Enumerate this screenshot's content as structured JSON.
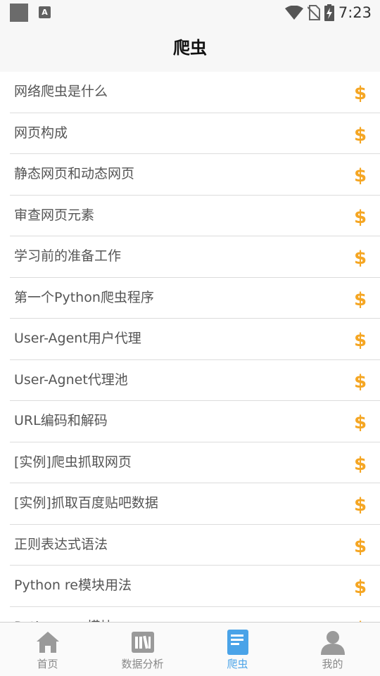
{
  "status_bar": {
    "time": "7:23",
    "icons": [
      "app-square-icon",
      "text-a-icon",
      "wifi-icon",
      "no-sim-icon",
      "battery-charging-icon"
    ]
  },
  "header": {
    "title": "爬虫"
  },
  "list": {
    "items": [
      {
        "label": "网络爬虫是什么"
      },
      {
        "label": "网页构成"
      },
      {
        "label": "静态网页和动态网页"
      },
      {
        "label": "审查网页元素"
      },
      {
        "label": "学习前的准备工作"
      },
      {
        "label": "第一个Python爬虫程序"
      },
      {
        "label": "User-Agent用户代理"
      },
      {
        "label": "User-Agnet代理池"
      },
      {
        "label": "URL编码和解码"
      },
      {
        "label": "[实例]爬虫抓取网页"
      },
      {
        "label": "[实例]抓取百度贴吧数据"
      },
      {
        "label": "正则表达式语法"
      },
      {
        "label": "Python re模块用法"
      },
      {
        "label": "Python csv模块"
      }
    ],
    "item_icon": "dollar-icon",
    "icon_color": "#f5a623"
  },
  "tabs": [
    {
      "label": "首页",
      "icon": "home-icon",
      "active": false
    },
    {
      "label": "数据分析",
      "icon": "books-icon",
      "active": false
    },
    {
      "label": "爬虫",
      "icon": "document-icon",
      "active": true
    },
    {
      "label": "我的",
      "icon": "person-icon",
      "active": false
    }
  ],
  "colors": {
    "accent": "#4aa3e8",
    "inactive": "#999999",
    "coin": "#f5a623"
  }
}
